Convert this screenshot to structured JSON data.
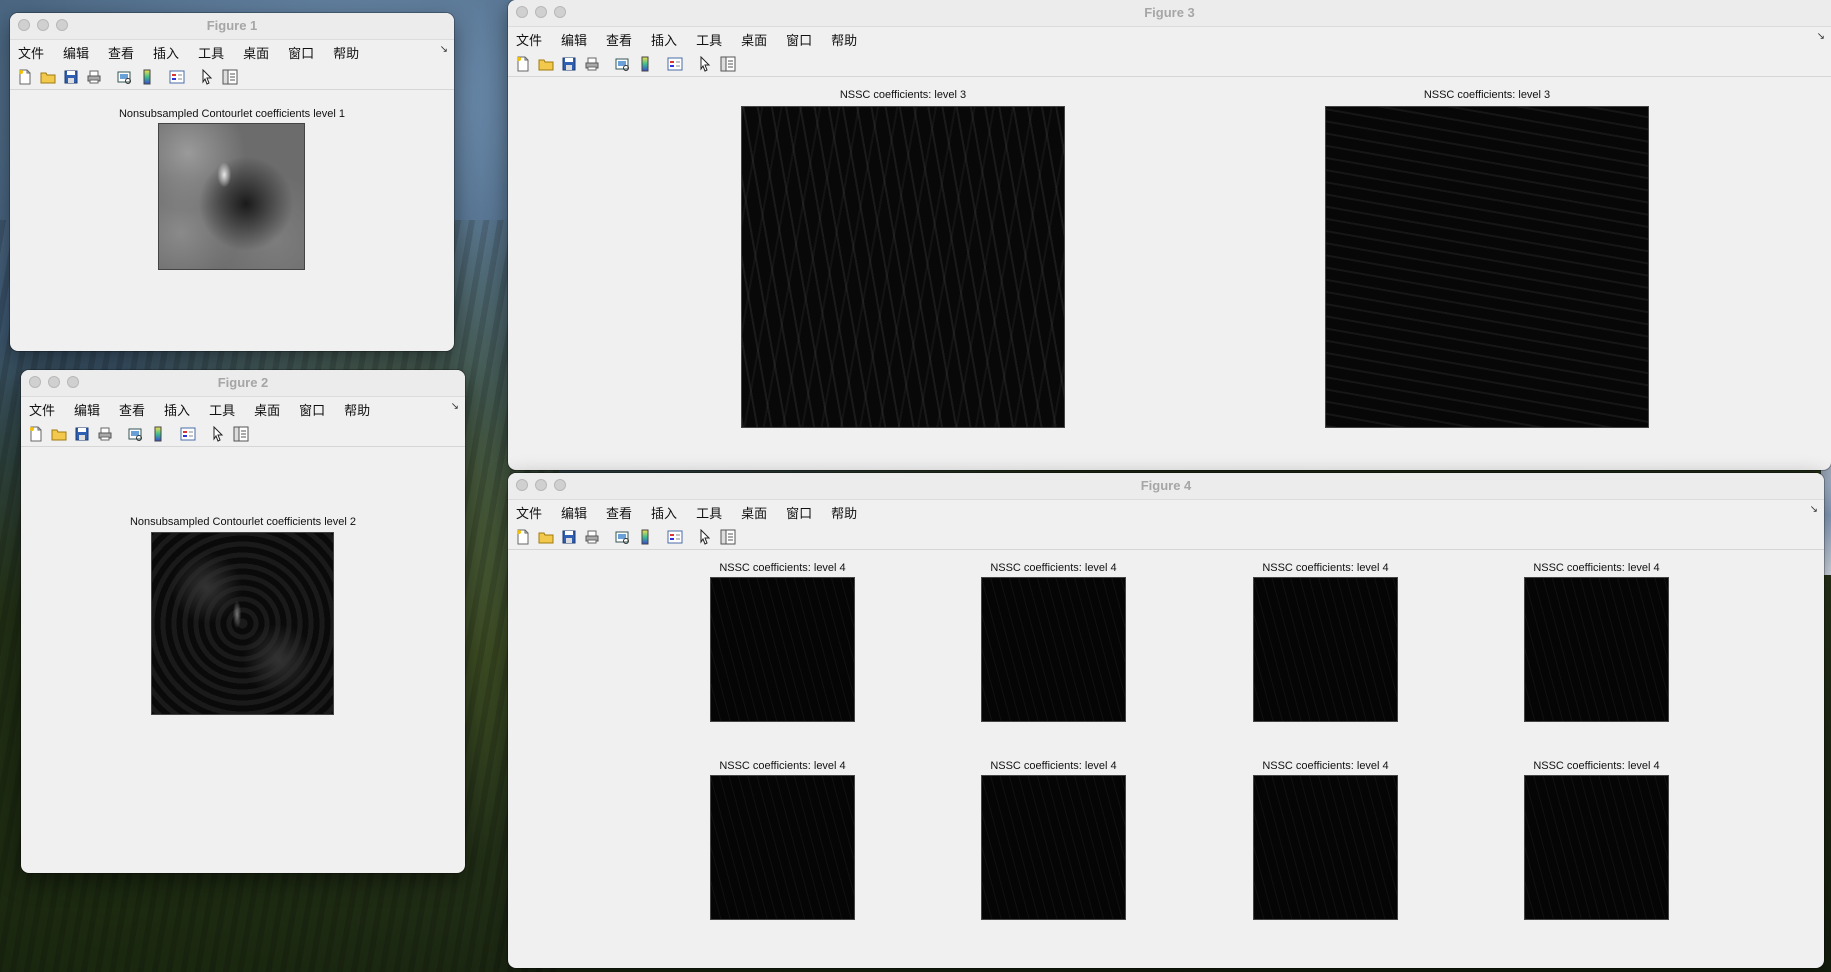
{
  "menu": [
    "文件",
    "编辑",
    "查看",
    "插入",
    "工具",
    "桌面",
    "窗口",
    "帮助"
  ],
  "toolbar_icons": [
    "new-file-icon",
    "open-folder-icon",
    "save-icon",
    "print-icon",
    "print-preview-icon",
    "colorbar-icon",
    "legend-icon",
    "pointer-icon",
    "property-inspector-icon"
  ],
  "figure1": {
    "title": "Figure 1",
    "plot_title": "Nonsubsampled Contourlet coefficients level 1"
  },
  "figure2": {
    "title": "Figure 2",
    "plot_title": "Nonsubsampled Contourlet coefficients level 2"
  },
  "figure3": {
    "title": "Figure 3",
    "plots": [
      "NSSC coefficients: level 3",
      "NSSC coefficients: level 3"
    ]
  },
  "figure4": {
    "title": "Figure 4",
    "plots": [
      "NSSC coefficients: level 4",
      "NSSC coefficients: level 4",
      "NSSC coefficients: level 4",
      "NSSC coefficients: level 4",
      "NSSC coefficients: level 4",
      "NSSC coefficients: level 4",
      "NSSC coefficients: level 4",
      "NSSC coefficients: level 4"
    ]
  },
  "colors": {
    "window_bg": "#f0f0f0",
    "title_text": "#a6a6a6",
    "image_dark": "#060606"
  }
}
